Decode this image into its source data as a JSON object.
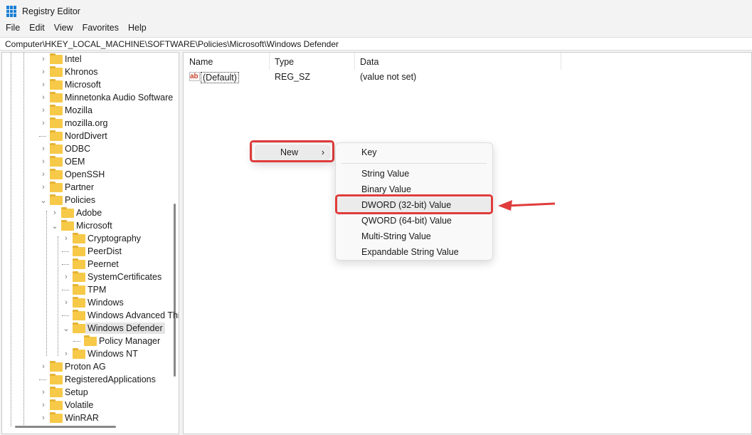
{
  "window": {
    "title": "Registry Editor"
  },
  "menu": [
    "File",
    "Edit",
    "View",
    "Favorites",
    "Help"
  ],
  "address": "Computer\\HKEY_LOCAL_MACHINE\\SOFTWARE\\Policies\\Microsoft\\Windows Defender",
  "tree": [
    {
      "label": "Intel",
      "level": 1,
      "exp": ">"
    },
    {
      "label": "Khronos",
      "level": 1,
      "exp": ">"
    },
    {
      "label": "Microsoft",
      "level": 1,
      "exp": ">"
    },
    {
      "label": "Minnetonka Audio Software",
      "level": 1,
      "exp": ">"
    },
    {
      "label": "Mozilla",
      "level": 1,
      "exp": ">"
    },
    {
      "label": "mozilla.org",
      "level": 1,
      "exp": ">"
    },
    {
      "label": "NordDivert",
      "level": 1,
      "exp": ""
    },
    {
      "label": "ODBC",
      "level": 1,
      "exp": ">"
    },
    {
      "label": "OEM",
      "level": 1,
      "exp": ">"
    },
    {
      "label": "OpenSSH",
      "level": 1,
      "exp": ">"
    },
    {
      "label": "Partner",
      "level": 1,
      "exp": ">"
    },
    {
      "label": "Policies",
      "level": 1,
      "exp": "v"
    },
    {
      "label": "Adobe",
      "level": 2,
      "exp": ">"
    },
    {
      "label": "Microsoft",
      "level": 2,
      "exp": "v"
    },
    {
      "label": "Cryptography",
      "level": 3,
      "exp": ">"
    },
    {
      "label": "PeerDist",
      "level": 3,
      "exp": ""
    },
    {
      "label": "Peernet",
      "level": 3,
      "exp": ""
    },
    {
      "label": "SystemCertificates",
      "level": 3,
      "exp": ">"
    },
    {
      "label": "TPM",
      "level": 3,
      "exp": ""
    },
    {
      "label": "Windows",
      "level": 3,
      "exp": ">"
    },
    {
      "label": "Windows Advanced Threat Protection",
      "level": 3,
      "exp": ""
    },
    {
      "label": "Windows Defender",
      "level": 3,
      "exp": "v",
      "selected": true
    },
    {
      "label": "Policy Manager",
      "level": 4,
      "exp": ""
    },
    {
      "label": "Windows NT",
      "level": 3,
      "exp": ">"
    },
    {
      "label": "Proton AG",
      "level": 1,
      "exp": ">"
    },
    {
      "label": "RegisteredApplications",
      "level": 1,
      "exp": ""
    },
    {
      "label": "Setup",
      "level": 1,
      "exp": ">"
    },
    {
      "label": "Volatile",
      "level": 1,
      "exp": ">"
    },
    {
      "label": "WinRAR",
      "level": 1,
      "exp": ">"
    }
  ],
  "values": {
    "headers": [
      "Name",
      "Type",
      "Data"
    ],
    "rows": [
      {
        "name": "(Default)",
        "type": "REG_SZ",
        "data": "(value not set)"
      }
    ]
  },
  "context_menu": {
    "new_label": "New",
    "submenu": [
      "Key",
      "String Value",
      "Binary Value",
      "DWORD (32-bit) Value",
      "QWORD (64-bit) Value",
      "Multi-String Value",
      "Expandable String Value"
    ]
  },
  "annotation_color": "#e03c3c"
}
